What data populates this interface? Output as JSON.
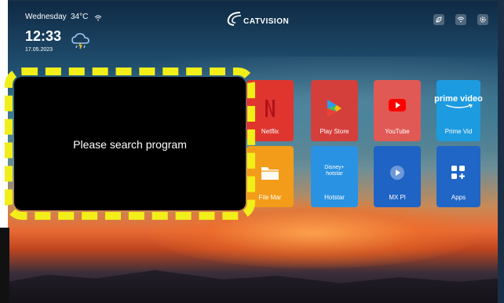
{
  "status": {
    "day": "Wednesday",
    "temperature": "34°C",
    "time": "12:33",
    "date": "17.05.2023",
    "weather_icon": "cloud-rain-icon"
  },
  "brand": {
    "logo_text": "CATVISION"
  },
  "top_icons": [
    "leaf-icon",
    "wifi-icon",
    "settings-icon"
  ],
  "apps": [
    {
      "label": "Netflix",
      "icon": "netflix-icon",
      "color": "#e73c3c"
    },
    {
      "label": "Play Store",
      "icon": "play-store-icon",
      "color": "#d6413f"
    },
    {
      "label": "YouTube",
      "icon": "youtube-icon",
      "color": "#e2504a"
    },
    {
      "label": "Prime Vid",
      "icon": "prime-video-icon",
      "color": "#1a9fe0"
    },
    {
      "label": "File Mar",
      "icon": "folder-icon",
      "color": "#f2a21e"
    },
    {
      "label": "Hotstar",
      "icon": "hotstar-icon",
      "color": "#2a8fe0"
    },
    {
      "label": "MX Pl",
      "icon": "mx-player-icon",
      "color": "#2166c8"
    },
    {
      "label": "Apps",
      "icon": "apps-icon",
      "color": "#1f69c8"
    }
  ],
  "popup": {
    "message": "Please search program"
  },
  "accent": {
    "highlight": "#f2ee1a"
  }
}
